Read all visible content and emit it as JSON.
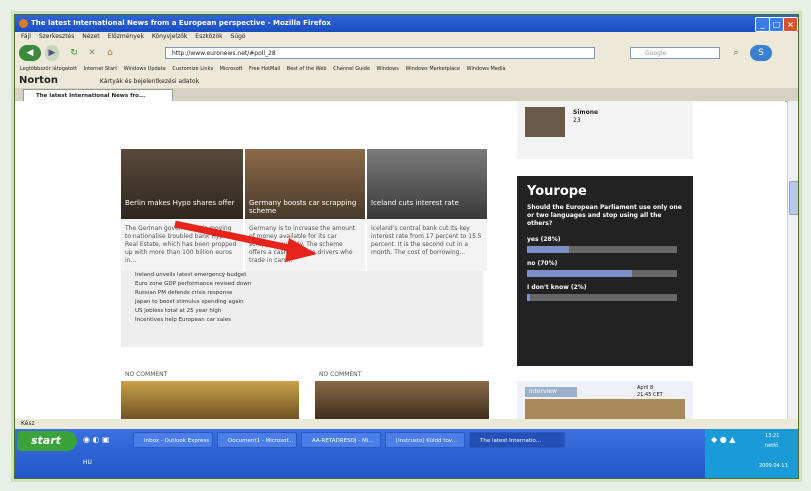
{
  "window": {
    "title": "The latest International News from a European perspective - Mozilla Firefox"
  },
  "menu": [
    "Fájl",
    "Szerkesztés",
    "Nézet",
    "Előzmények",
    "Könyvjelzők",
    "Eszközök",
    "Súgó"
  ],
  "nav": {
    "url": "http://www.euronews.net/#poll_28",
    "search_placeholder": "Google"
  },
  "bookmarks": [
    "Legtöbbször látogatott",
    "Internet Start",
    "Windows Update",
    "Customize Links",
    "Microsoft",
    "Free HotMail",
    "Best of the Web",
    "Channel Guide",
    "Windows",
    "Windows Marketplace",
    "Windows Media"
  ],
  "norton": {
    "label": "Norton",
    "privacy": "Kártyák és bejelentkezési adatok"
  },
  "tab": {
    "label": "The latest International News fro..."
  },
  "stories": [
    {
      "caption": "Berlin makes Hypo shares offer",
      "blurb": "The German government is moving to nationalise troubled bank Hypo Real Estate, which has been propped up with more than 100 billion euros in..."
    },
    {
      "caption": "Germany boosts car scrapping scheme",
      "blurb": "Germany is to increase the amount of money available for its car scrapping subsidy. The scheme offers a cash bonus to drivers who trade in cars..."
    },
    {
      "caption": "Iceland cuts interest rate",
      "blurb": "Iceland's central bank cut its key interest rate from 17 percent to 15.5 percent. It is the second cut in a month. The cost of borrowing..."
    }
  ],
  "headlines": [
    "Ireland unveils latest emergency budget",
    "Euro zone GDP performance revised down",
    "Russian PM defends crisis response",
    "Japan to boost stimulus spending again",
    "US jobless total at 25 year high",
    "Incentives help European car sales"
  ],
  "no_comment": [
    "NO COMMENT",
    "NO COMMENT"
  ],
  "profile": {
    "name": "Simone",
    "age": "23"
  },
  "poll": {
    "title": "Yourope",
    "question": "Should the European Parliament use only one or two languages and stop using all the others?",
    "options": [
      {
        "label": "yes (28%)",
        "value": 28
      },
      {
        "label": "no (70%)",
        "value": 70
      },
      {
        "label": "I don't know (2%)",
        "value": 2
      }
    ]
  },
  "interview": {
    "label": "Interview",
    "date": "April 8",
    "time": "21:45 CET"
  },
  "status": "Kész",
  "taskbar": {
    "start": "start",
    "items": [
      "Inbox - Outlook Express",
      "Document1 - Microsof...",
      "AA-RETADRESOJ - Mi...",
      "[instrusto] Küldd tov...",
      "The latest Internatio..."
    ],
    "lang": "HU",
    "time": "13:21",
    "day": "hétfő",
    "date": "2009.04.13."
  }
}
